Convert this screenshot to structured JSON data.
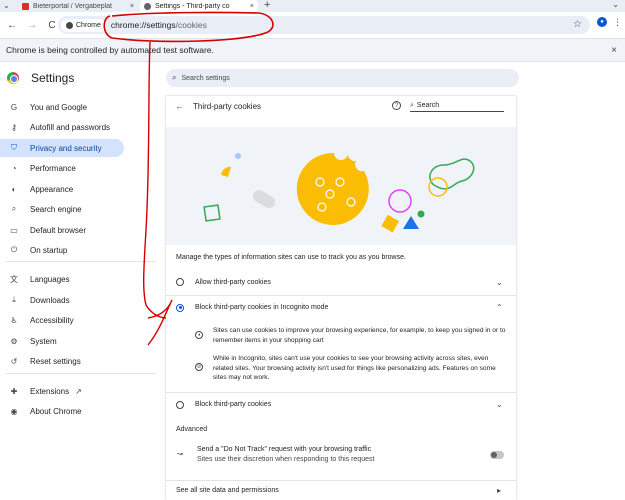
{
  "browser": {
    "tabs": [
      {
        "title": "Bieterportal / Vergabeplat",
        "close": "×"
      },
      {
        "title": "Settings - Third-party co",
        "close": "×"
      }
    ],
    "new_tab": "+",
    "tab_search": "⌄",
    "window_controls": "⌄",
    "nav": {
      "back": "←",
      "forward": "→",
      "reload": "C"
    },
    "address": {
      "chip": "Chrome",
      "host": "chrome://settings",
      "path": "/cookies"
    },
    "bookmark_icon": "☆",
    "menu_icon": "⋮",
    "profile_icon": "person-icon",
    "profile_glyph": "●",
    "infobar": {
      "message": "Chrome is being controlled by automated test software.",
      "close": "×"
    }
  },
  "settings": {
    "title": "Settings",
    "search_placeholder": "Search settings",
    "sidebar": [
      {
        "label": "You and Google",
        "icon": "G"
      },
      {
        "label": "Autofill and passwords",
        "icon": "⚷"
      },
      {
        "label": "Privacy and security",
        "icon": "⛉",
        "active": true
      },
      {
        "label": "Performance",
        "icon": "◔"
      },
      {
        "label": "Appearance",
        "icon": "◐"
      },
      {
        "label": "Search engine",
        "icon": "⌕"
      },
      {
        "label": "Default browser",
        "icon": "▭"
      },
      {
        "label": "On startup",
        "icon": "⏻"
      },
      {
        "label": "Languages",
        "icon": "文"
      },
      {
        "label": "Downloads",
        "icon": "⤓"
      },
      {
        "label": "Accessibility",
        "icon": "♿"
      },
      {
        "label": "System",
        "icon": "⚙"
      },
      {
        "label": "Reset settings",
        "icon": "↺"
      },
      {
        "label": "Extensions",
        "icon": "✚",
        "external": "↗"
      },
      {
        "label": "About Chrome",
        "icon": "◉"
      }
    ],
    "subpage": {
      "back": "←",
      "title": "Third-party cookies",
      "help": "?",
      "search_placeholder": "Search",
      "description": "Manage the types of information sites can use to track you as you browse.",
      "options": [
        {
          "label": "Allow third-party cookies",
          "selected": false,
          "chevron": "⌄"
        },
        {
          "label": "Block third-party cookies in Incognito mode",
          "selected": true,
          "chevron": "⌃"
        },
        {
          "label": "Block third-party cookies",
          "selected": false,
          "chevron": "⌄"
        }
      ],
      "details": [
        {
          "icon": "cookie-icon",
          "glyph": "◕",
          "text": "Sites can use cookies to improve your browsing experience, for example, to keep you signed in or to remember items in your shopping cart"
        },
        {
          "icon": "block-icon",
          "glyph": "⊘",
          "text": "While in Incognito, sites can't use your cookies to see your browsing activity across sites, even related sites. Your browsing activity isn't used for things like personalizing ads. Features on some sites may not work."
        }
      ],
      "advanced_heading": "Advanced",
      "dnt": {
        "title": "Send a \"Do Not Track\" request with your browsing traffic",
        "subtitle": "Sites use their discretion when responding to this request",
        "enabled": false,
        "icon_glyph": "↝"
      },
      "all_site_data": "See all site data and permissions",
      "all_site_arrow": "▸"
    }
  },
  "colors": {
    "accent": "#0b57d0",
    "active_bg": "#d3e3fd",
    "annotation": "#d40000",
    "cookie": "#fbbc04"
  }
}
